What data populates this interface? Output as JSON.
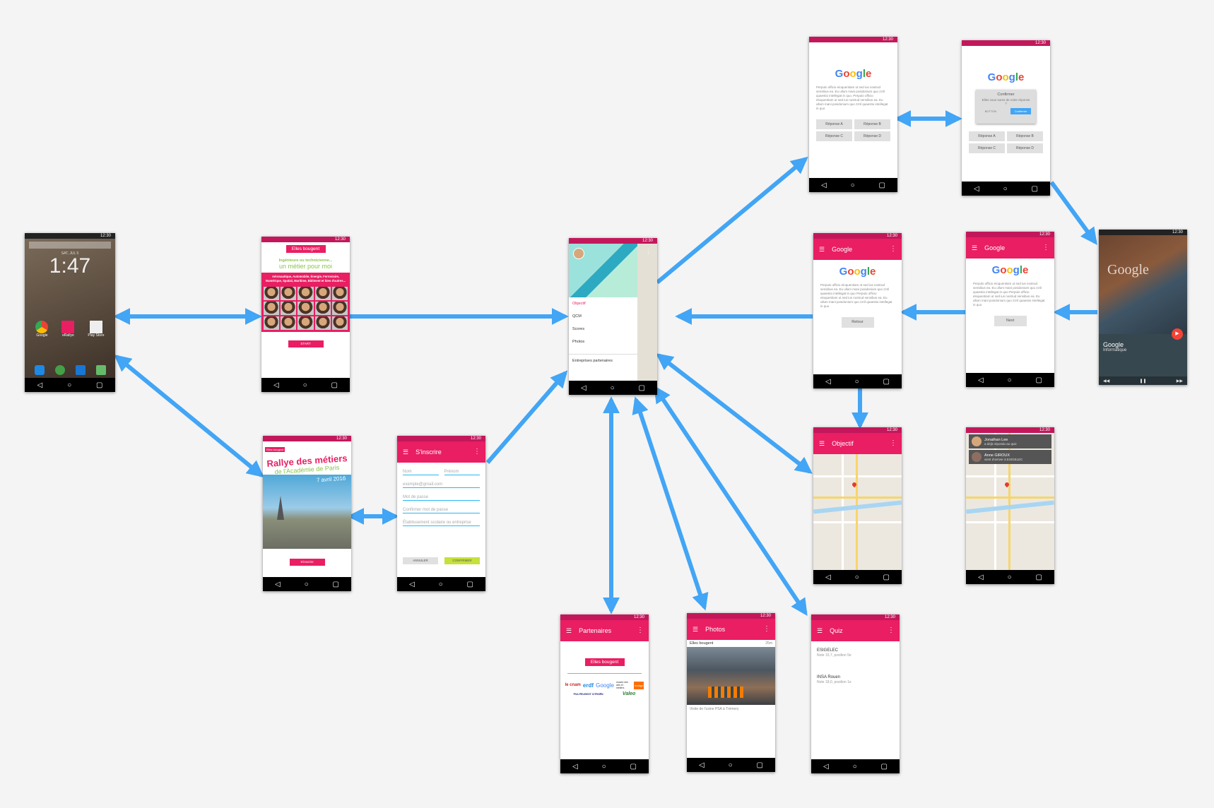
{
  "home": {
    "date": "SAT, JUL 5",
    "time": "1:47",
    "apps": [
      "Google",
      "eRallye",
      "Play Store"
    ],
    "status_time": "12:30"
  },
  "splash": {
    "logo": "Elles bougent",
    "line1": "Ingénieure ou technicienne...",
    "line2": "un métier pour moi",
    "sectors": "Aéronautique, Automobile, Énergie, Ferroviaire, Numérique, Spatial, Maritime, Bâtiment et bien d'autres...",
    "start": "START",
    "status_time": "12:30"
  },
  "rallye": {
    "badge": "Elles bougent",
    "title": "Rallye des métiers",
    "subtitle": "de l'Académie de Paris",
    "date": "7 avril 2016",
    "button": "S'inscrire",
    "status_time": "12:30"
  },
  "signup": {
    "title": "S'inscrire",
    "nom": "Nom",
    "prenom": "Prénom",
    "email": "exemple@gmail.com",
    "password": "Mot de passe",
    "confirm": "Confirmer mot de passe",
    "school": "Établissement scolaire ou entreprise",
    "cancel": "ANNULER",
    "ok": "CONFIRMER",
    "status_time": "12:30"
  },
  "drawer": {
    "items": [
      "Objectif",
      "QCM",
      "Scores",
      "Photos"
    ],
    "partners": "Entreprises partenaires",
    "status_time": "12:30"
  },
  "quiz1": {
    "lorem": "Perpulo officio eloquentiam ut sed ius nostrud sensibus ea. Eu ullum mani posidonium quo zzril quaestio intellegat in quo. Perpulo officio eloquentiam ut sed ius nostrud sensibus ea. Eu ullum mani posidonium quo zzril quaestio intellegat in quo",
    "answers": [
      "Réponse A",
      "Réponse B",
      "Réponse C",
      "Réponse D"
    ],
    "status_time": "12:30"
  },
  "quiz2": {
    "dialog_title": "Confirmer",
    "dialog_text": "Elles vous sures de votre réponse ?",
    "dialog_cancel": "BOTTON",
    "dialog_ok": "Confirmer",
    "answers": [
      "Réponse A",
      "Réponse B",
      "Réponse C",
      "Réponse D"
    ],
    "status_time": "12:30"
  },
  "company1": {
    "title": "Google",
    "button": "Retour",
    "lorem": "Perpulo officio eloquentiam ut sed ius nostrud sensibus ea. Eu ullum mani posidonium quo zzril quaestio intellegat in quo Perpulo officio eloquentiam ut sed ius nostrud sensibus ea. Eu ullum mani posidonium quo zzril quaestio intellegat in quo",
    "status_time": "12:30"
  },
  "company2": {
    "title": "Google",
    "button": "Next",
    "lorem": "Perpulo officio eloquentiam ut sed ius nostrud sensibus ea. Eu ullum mani posidonium quo zzril quaestio intellegat in quo Perpulo officio eloquentiam ut sed ius nostrud sensibus ea. Eu ullum mani posidonium quo zzril quaestio intellegat in quo",
    "status_time": "12:30"
  },
  "video": {
    "title": "Google",
    "subtitle": "Informatique",
    "watermark": "Google",
    "status_time": "12:30"
  },
  "objectif": {
    "title": "Objectif",
    "status_time": "12:30"
  },
  "map2": {
    "user1": "Jonathan Lee",
    "user1_sub": "a déjà répondu au quiz",
    "user2": "Anne GIROUX",
    "user2_sub": "vient d'arriver à ESIGELEC",
    "status_time": "12:30"
  },
  "partners": {
    "title": "Partenaires",
    "logo": "Elles bougent",
    "list": [
      "le cnam",
      "erdf",
      "Google",
      "musée des arts et métiers",
      "orange",
      "PSA PEUGEOT CITROËN",
      "Valeo"
    ],
    "status_time": "12:30"
  },
  "photos": {
    "title": "Photos",
    "group": "Elles bougent",
    "age": "25m",
    "caption": "Visite de l'usine PSA à Trémery",
    "status_time": "12:30"
  },
  "quizlist": {
    "title": "Quiz",
    "items": [
      {
        "name": "ESIGELEC",
        "sub": "Note 15,7, position 5e"
      },
      {
        "name": "INSA Rouen",
        "sub": "Note 18,0, position 1e"
      }
    ],
    "status_time": "12:30"
  },
  "colors": {
    "primary": "#e91e63",
    "dark": "#c2185b",
    "arrow": "#42a5f5",
    "green": "#8bc34a"
  }
}
